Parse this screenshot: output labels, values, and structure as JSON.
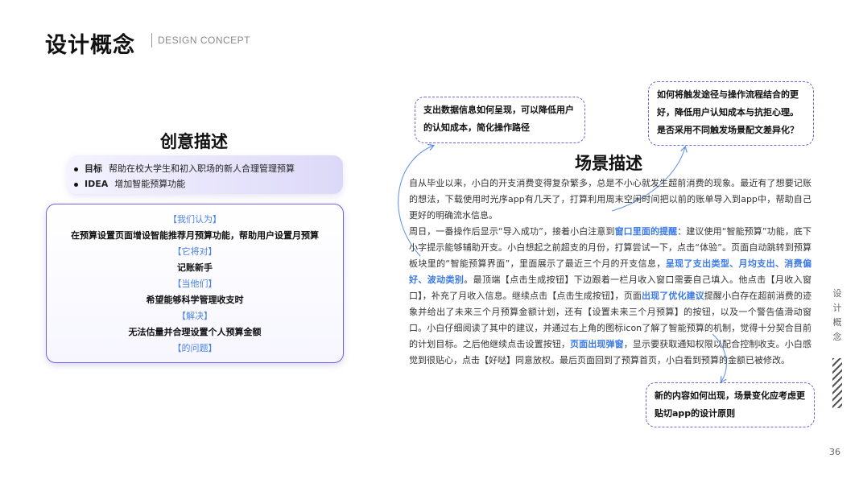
{
  "header": {
    "title": "设计概念",
    "subtitle": "DESIGN CONCEPT"
  },
  "left": {
    "heading": "创意描述",
    "goals": [
      {
        "key": "目标",
        "text": "帮助在校大学生和初入职场的新人合理管理预算"
      },
      {
        "key": "IDEA",
        "text": "增加智能预算功能"
      }
    ],
    "frame": [
      {
        "kind": "tag",
        "text": "【我们认为】"
      },
      {
        "kind": "text",
        "text": "在预算设置页面增设智能推荐月预算功能，帮助用户设置月预算"
      },
      {
        "kind": "tag",
        "text": "【它将对】"
      },
      {
        "kind": "text",
        "text": "记账新手"
      },
      {
        "kind": "tag",
        "text": "【当他们】"
      },
      {
        "kind": "text",
        "text": "希望能够科学管理收支时"
      },
      {
        "kind": "tag",
        "text": "【解决】"
      },
      {
        "kind": "text",
        "text": "无法估量并合理设置个人预算金额"
      },
      {
        "kind": "tag",
        "text": "【的问题】"
      }
    ]
  },
  "callouts": {
    "top_left": "支出数据信息如何呈现，可以降低用户的认知成本，简化操作路径",
    "top_right": "如何将触发途径与操作流程结合的更好，降低用户认知成本与抗拒心理。是否采用不同触发场景配文差异化？",
    "bottom_right": "新的内容如何出现，场景变化应考虑更贴切app的设计原则"
  },
  "right": {
    "heading": "场景描述",
    "para1": "自从毕业以来，小白的开支消费变得复杂繁多，总是不小心就发生超前消费的现象。最近有了想要记账的想法，下载使用时光序app有几天了，打算利用周末空闲时间把以前的账单导入到app中，帮助自己更好的明确流水信息。",
    "para2": [
      {
        "t": "周日，一番操作后显示“导入成功”，接着小白注意到",
        "hl": false
      },
      {
        "t": "窗口里面的提醒",
        "hl": true
      },
      {
        "t": "：建议使用“智能预算”功能，底下小字提示能够辅助开支。小白想起之前超支的月份，打算尝试一下，点击“体验”。页面自动跳转到预算板块里的“智能预算界面”，里面展示了最近三个月的开支信息，",
        "hl": false
      },
      {
        "t": "呈现了支出类型、月均支出、消费偏好、波动类别",
        "hl": true
      },
      {
        "t": "。最顶端【点击生成按钮】下边跟着一栏月收入窗口需要自己填入。他点击【月收入窗口】，补充了月收入信息。继续点击【点击生成按钮】，页面",
        "hl": false
      },
      {
        "t": "出现了优化建议",
        "hl": true
      },
      {
        "t": "提醒小白存在超前消费的迹象并给出了未来三个月预算金额计划，还有【设置未来三个月预算】的按钮，以及一个警告值滑动窗口。小白仔细阅读了其中的建议，并通过右上角的图标icon了解了智能预算的机制，觉得十分契合目前的计划目标。之后他继续点击设置按钮，",
        "hl": false
      },
      {
        "t": "页面出现弹窗",
        "hl": true
      },
      {
        "t": "，显示要获取通知权限以配合控制收支。小白感觉到很贴心，点击【好哒】同意放权。最后页面回到了预算首页，小白看到预算的金额已被修改。",
        "hl": false
      }
    ]
  },
  "side_label": "设计概念",
  "page_number": "36",
  "colors": {
    "accent": "#6b63d8",
    "highlight": "#3c7ae6",
    "tag": "#4a82e6"
  }
}
